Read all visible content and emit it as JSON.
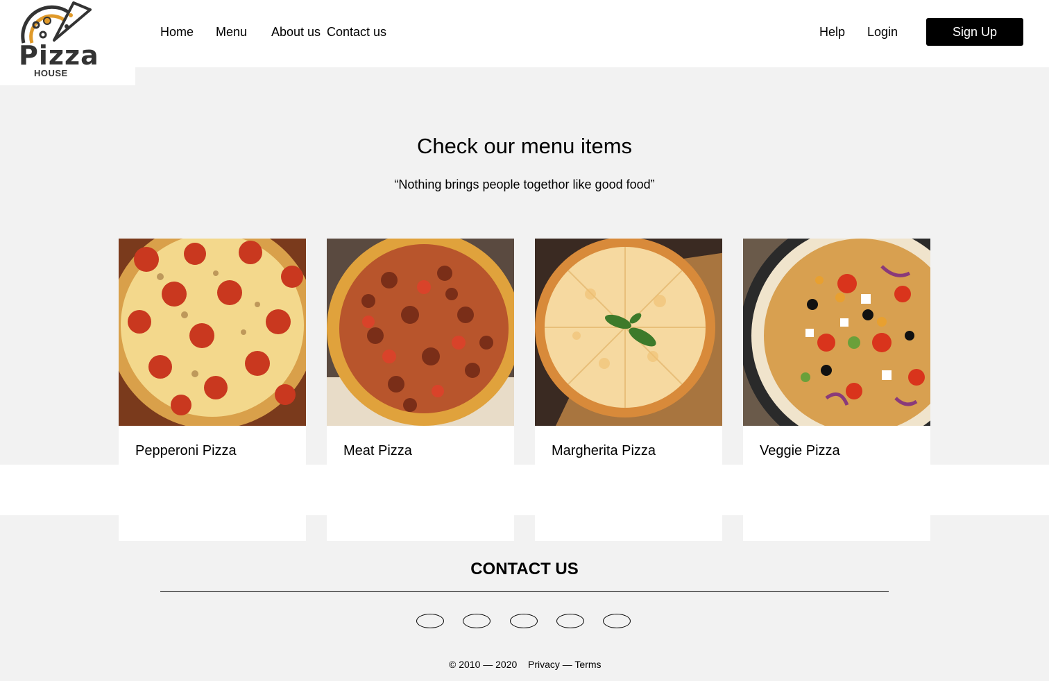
{
  "brand": {
    "logo_word": "Pizza",
    "logo_sub": "HOUSE"
  },
  "nav": {
    "left": [
      "Home",
      "Menu",
      "About us",
      "Contact us"
    ],
    "help": "Help",
    "login": "Login",
    "signup": "Sign Up"
  },
  "hero": {
    "title": "Check our menu items",
    "subtitle": "“Nothing brings people togethor like good food”"
  },
  "menu_items": [
    {
      "name": "Pepperoni Pizza"
    },
    {
      "name": "Meat Pizza"
    },
    {
      "name": "Margherita Pizza"
    },
    {
      "name": "Veggie Pizza"
    }
  ],
  "contact": {
    "title": "CONTACT US",
    "social_count": 5
  },
  "footer": {
    "copyright": "© 2010 — 2020",
    "links": "Privacy — Terms"
  },
  "colors": {
    "accent": "#e09a2a",
    "button_bg": "#000000",
    "page_bg": "#f2f2f2"
  }
}
